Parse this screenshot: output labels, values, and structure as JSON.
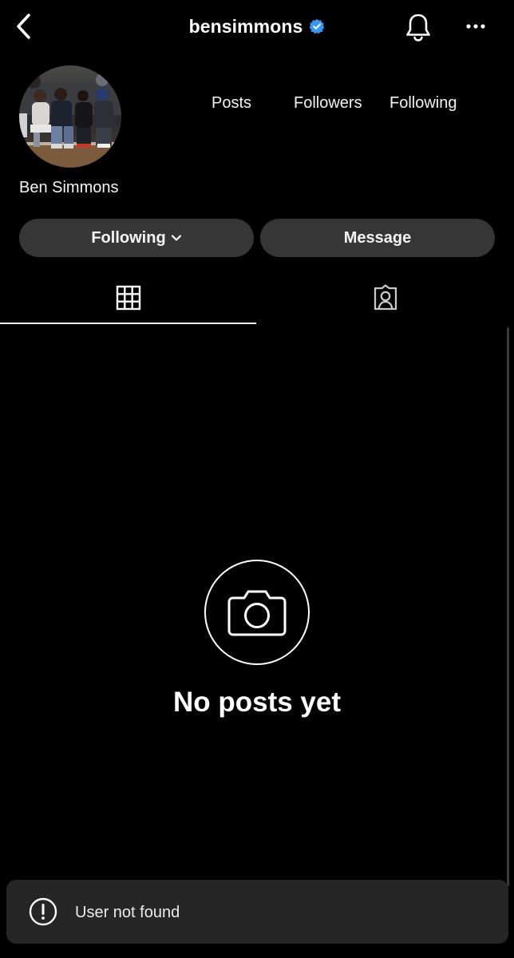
{
  "header": {
    "username": "bensimmons"
  },
  "profile": {
    "display_name": "Ben Simmons",
    "stats": {
      "posts_label": "Posts",
      "followers_label": "Followers",
      "following_label": "Following"
    }
  },
  "actions": {
    "following_label": "Following",
    "message_label": "Message"
  },
  "tabs": [
    {
      "icon": "grid-icon",
      "selected": true
    },
    {
      "icon": "tagged-icon",
      "selected": false
    }
  ],
  "empty_state": {
    "icon": "camera-icon",
    "text": "No posts yet"
  },
  "toast": {
    "icon": "alert-icon",
    "text": "User not found"
  },
  "colors": {
    "background": "#000000",
    "button": "#363636",
    "toast": "#262626",
    "verified": "#3897f0"
  }
}
